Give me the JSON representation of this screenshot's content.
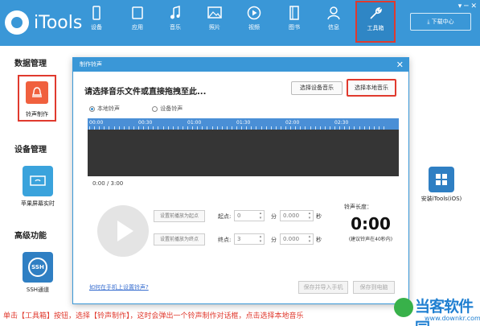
{
  "app": {
    "name": "iTools"
  },
  "nav": [
    {
      "label": "设备",
      "icon": "phone-icon"
    },
    {
      "label": "应用",
      "icon": "apps-icon"
    },
    {
      "label": "音乐",
      "icon": "music-icon"
    },
    {
      "label": "照片",
      "icon": "photo-icon"
    },
    {
      "label": "视频",
      "icon": "video-icon"
    },
    {
      "label": "图书",
      "icon": "book-icon"
    },
    {
      "label": "信息",
      "icon": "contacts-icon"
    },
    {
      "label": "工具箱",
      "icon": "wrench-icon",
      "active": true
    }
  ],
  "download_center": "下载中心",
  "sidebar": {
    "section1": "数据管理",
    "ringtone": "铃声制作",
    "section2": "设备管理",
    "screen": "苹果屏幕实时",
    "section3": "高级功能",
    "ssh": "SSH通道",
    "install_itools": "安装iTools(iOS)"
  },
  "dialog": {
    "title": "制作铃声",
    "prompt": "请选择音乐文件或直接拖拽至此...",
    "btn_device_music": "选择设备音乐",
    "btn_local_music": "选择本地音乐",
    "radio_local": "本地铃声",
    "radio_device": "设备铃声",
    "ticks": [
      "00:00",
      "00:30",
      "01:00",
      "01:30",
      "02:00",
      "02:30"
    ],
    "current_time": "0:00 / 3:00",
    "set_start": "设置前播放为起点",
    "set_end": "设置前播放为终点",
    "start_label": "起点:",
    "end_label": "终点:",
    "start_min": "0",
    "start_sec": "0.000",
    "end_min": "3",
    "end_sec": "0.000",
    "min_unit": "分",
    "sec_unit": "秒",
    "length_label": "铃声长度：",
    "length_value": "0:00",
    "length_note": "(建议铃声在40秒内)",
    "link": "如何在手机上设置铃声?",
    "btn_save_import": "保存并导入手机",
    "btn_save_local": "保存到电脑"
  },
  "bottom_note": "单击【工具箱】按钮，选择【铃声制作】，这时会弹出一个铃声制作对话框，点击选择本地音乐",
  "watermark": {
    "name": "当客软件园",
    "url": "www.downkr.com"
  },
  "colors": {
    "brand": "#3a97d7",
    "highlight": "#e03a2e",
    "note": "#e03a2e"
  }
}
